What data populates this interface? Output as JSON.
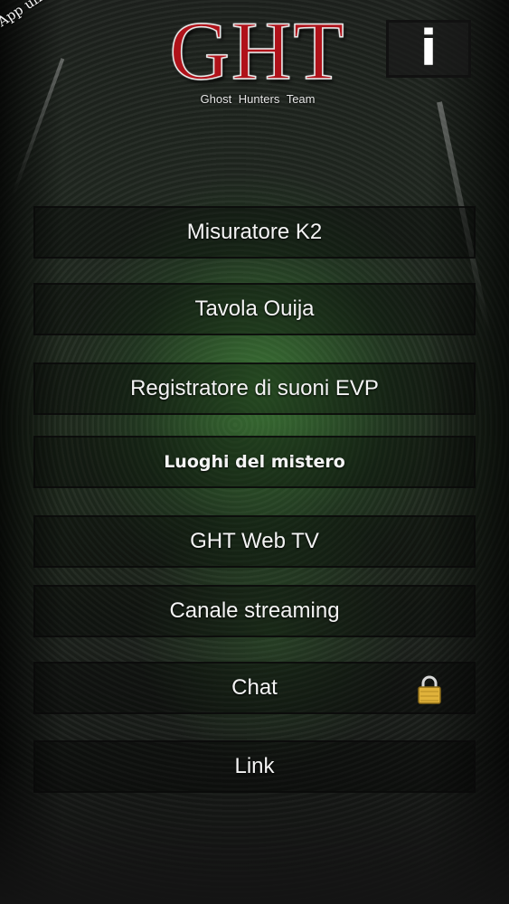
{
  "header": {
    "ribbon_label": "App ufficiale",
    "logo_title": "GHT",
    "logo_subtitle": "Ghost Hunters Team",
    "info_icon": "i"
  },
  "menu": {
    "items": [
      {
        "label": "Misuratore K2"
      },
      {
        "label": "Tavola Ouija"
      },
      {
        "label": "Registratore di suoni EVP"
      },
      {
        "label": "Luoghi del mistero"
      },
      {
        "label": "GHT Web TV"
      },
      {
        "label": "Canale streaming"
      },
      {
        "label": "Chat",
        "icon": "lock-icon"
      },
      {
        "label": "Link"
      }
    ]
  },
  "colors": {
    "logo_red": "#b0121a",
    "lock_gold": "#e0b23a"
  }
}
